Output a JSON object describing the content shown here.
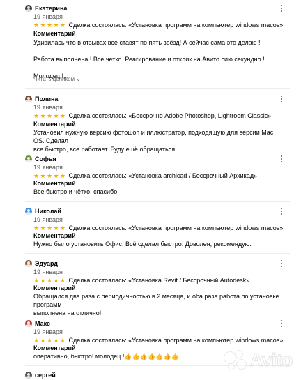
{
  "reviews": [
    {
      "name": "Екатерина",
      "date": "19 января",
      "rating": 5,
      "deal": "Сделка состоялась: «Установка программ на компьютер windows macos»",
      "comment_label": "Комментарий",
      "comment": [
        "Удивилась что в отзывах все ставят по пять звёзд! А сейчас сама это делаю !",
        "",
        "Работа выполнена ! Все четко. Реагирование и отклик на Авито сию секундно !",
        "",
        "Молодец !..."
      ],
      "show_more": "Читать целиком"
    },
    {
      "name": "Полина",
      "date": "19 января",
      "rating": 5,
      "deal": "Сделка состоялась: «Бессрочно Adobe Photoshop, Lightroom Classic»",
      "comment_label": "Комментарий",
      "comment": [
        "Установил нужную версию фотошоп и иллюстратор, подходящую для версии Mac OS. Сделал",
        "все быстро, все работает. Буду ещё обращаться"
      ]
    },
    {
      "name": "Софья",
      "date": "19 января",
      "rating": 5,
      "deal": "Сделка состоялась: «Установка archicad / Бессрочный Архикад»",
      "comment_label": "Комментарий",
      "comment": [
        "Все быстро и чётко, спасибо!"
      ]
    },
    {
      "name": "Николай",
      "date": "19 января",
      "rating": 5,
      "deal": "Сделка состоялась: «Установка программ на компьютер windows macos»",
      "comment_label": "Комментарий",
      "comment": [
        "Нужно было установить Офис. Всё сделал быстро. Доволен, рекомендую."
      ]
    },
    {
      "name": "Эдуард",
      "date": "19 января",
      "rating": 5,
      "deal": "Сделка состоялась: «Установка Revit / Бессрочный Autodesk»",
      "comment_label": "Комментарий",
      "comment": [
        "Обращался два раза с периодичностью в 2 месяца, и оба раза работа по установке программ",
        "выполнена на отлично!"
      ]
    },
    {
      "name": "Макс",
      "date": "19 января",
      "rating": 5,
      "deal": "Сделка состоялась: «Установка программ на компьютер windows macos»",
      "comment_label": "Комментарий",
      "comment": [
        "оперативно, быстро! молодец !👍👍👍👍👍👍👍"
      ]
    },
    {
      "name": "сергей"
    }
  ],
  "watermark": "Avito",
  "colors": {
    "star": "#f2ad00",
    "avatars": [
      "#3a3a3a",
      "#7a4a3a",
      "#6f8f3e",
      "#3e8fe0",
      "#8a5a3a",
      "#b33a3a",
      "#555555"
    ]
  }
}
